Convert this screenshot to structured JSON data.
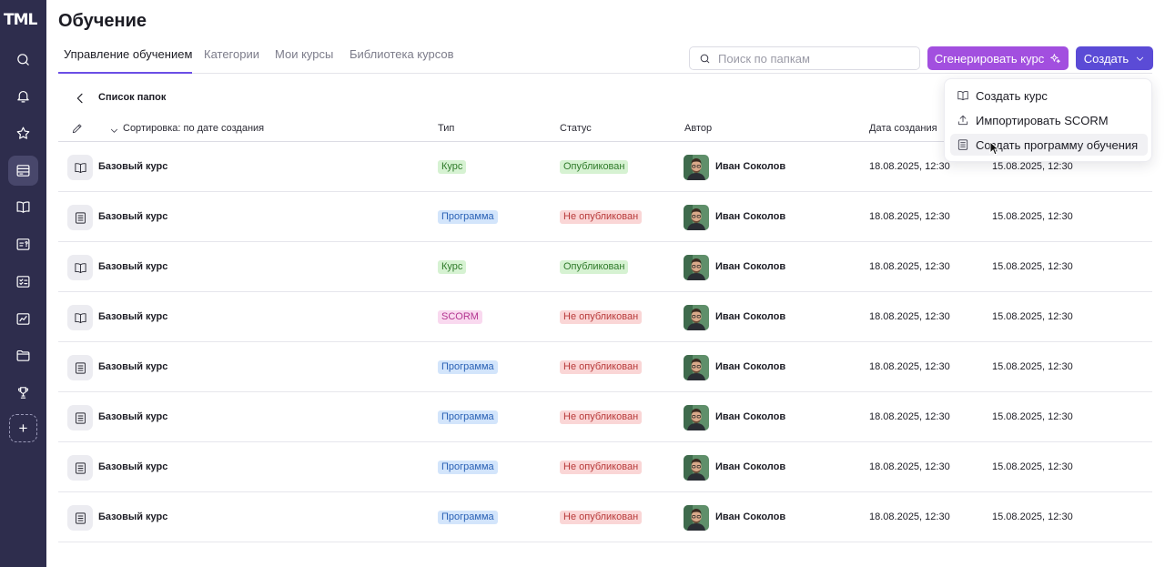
{
  "app": {
    "logo": "TML"
  },
  "header": {
    "title": "Обучение",
    "tabs": [
      {
        "label": "Управление обучением",
        "active": true
      },
      {
        "label": "Категории",
        "active": false
      },
      {
        "label": "Мои курсы",
        "active": false
      },
      {
        "label": "Библиотека курсов",
        "active": false
      }
    ],
    "search_placeholder": "Поиск по папкам",
    "generate_label": "Сгенерировать курс",
    "create_label": "Создать"
  },
  "sidebar": {
    "items": [
      {
        "icon": "search-icon",
        "active": false
      },
      {
        "icon": "bell-icon",
        "active": false
      },
      {
        "icon": "star-icon",
        "active": false
      },
      {
        "icon": "learning-icon",
        "active": true
      },
      {
        "icon": "book-icon",
        "active": false
      },
      {
        "icon": "quiz-icon",
        "active": false
      },
      {
        "icon": "checklist-icon",
        "active": false
      },
      {
        "icon": "analytics-icon",
        "active": false
      },
      {
        "icon": "folder-icon",
        "active": false
      },
      {
        "icon": "trophy-icon",
        "active": false
      }
    ],
    "add_icon": "plus-icon"
  },
  "breadcrumb": {
    "label": "Список папок"
  },
  "table": {
    "columns": {
      "sort": "Сортировка: по дате создания",
      "type": "Тип",
      "status": "Статус",
      "author": "Автор",
      "created": "Дата создания"
    },
    "rows": [
      {
        "icon": "book-icon",
        "name": "Базовый курс",
        "type": "Курс",
        "type_kind": "course",
        "status": "Опубликован",
        "status_kind": "pub",
        "author": "Иван Соколов",
        "created": "18.08.2025, 12:30",
        "updated": "15.08.2025, 12:30"
      },
      {
        "icon": "list-icon",
        "name": "Базовый курс",
        "type": "Программа",
        "type_kind": "program",
        "status": "Не опубликован",
        "status_kind": "unpub",
        "author": "Иван Соколов",
        "created": "18.08.2025, 12:30",
        "updated": "15.08.2025, 12:30"
      },
      {
        "icon": "book-icon",
        "name": "Базовый курс",
        "type": "Курс",
        "type_kind": "course",
        "status": "Опубликован",
        "status_kind": "pub",
        "author": "Иван Соколов",
        "created": "18.08.2025, 12:30",
        "updated": "15.08.2025, 12:30"
      },
      {
        "icon": "book-icon",
        "name": "Базовый курс",
        "type": "SCORM",
        "type_kind": "scorm",
        "status": "Не опубликован",
        "status_kind": "unpub",
        "author": "Иван Соколов",
        "created": "18.08.2025, 12:30",
        "updated": "15.08.2025, 12:30"
      },
      {
        "icon": "list-icon",
        "name": "Базовый курс",
        "type": "Программа",
        "type_kind": "program",
        "status": "Не опубликован",
        "status_kind": "unpub",
        "author": "Иван Соколов",
        "created": "18.08.2025, 12:30",
        "updated": "15.08.2025, 12:30"
      },
      {
        "icon": "list-icon",
        "name": "Базовый курс",
        "type": "Программа",
        "type_kind": "program",
        "status": "Не опубликован",
        "status_kind": "unpub",
        "author": "Иван Соколов",
        "created": "18.08.2025, 12:30",
        "updated": "15.08.2025, 12:30"
      },
      {
        "icon": "list-icon",
        "name": "Базовый курс",
        "type": "Программа",
        "type_kind": "program",
        "status": "Не опубликован",
        "status_kind": "unpub",
        "author": "Иван Соколов",
        "created": "18.08.2025, 12:30",
        "updated": "15.08.2025, 12:30"
      },
      {
        "icon": "list-icon",
        "name": "Базовый курс",
        "type": "Программа",
        "type_kind": "program",
        "status": "Не опубликован",
        "status_kind": "unpub",
        "author": "Иван Соколов",
        "created": "18.08.2025, 12:30",
        "updated": "15.08.2025, 12:30"
      }
    ]
  },
  "dropdown": {
    "items": [
      {
        "icon": "book-icon",
        "label": "Создать курс",
        "hover": false
      },
      {
        "icon": "upload-icon",
        "label": "Импортировать SCORM",
        "hover": false
      },
      {
        "icon": "list-icon",
        "label": "Создать программу обучения",
        "hover": true
      }
    ]
  },
  "colors": {
    "sidebar": "#2e2d4d",
    "accent": "#6b4ee6",
    "generate": "#a24fdf",
    "create": "#5b4bd6"
  }
}
